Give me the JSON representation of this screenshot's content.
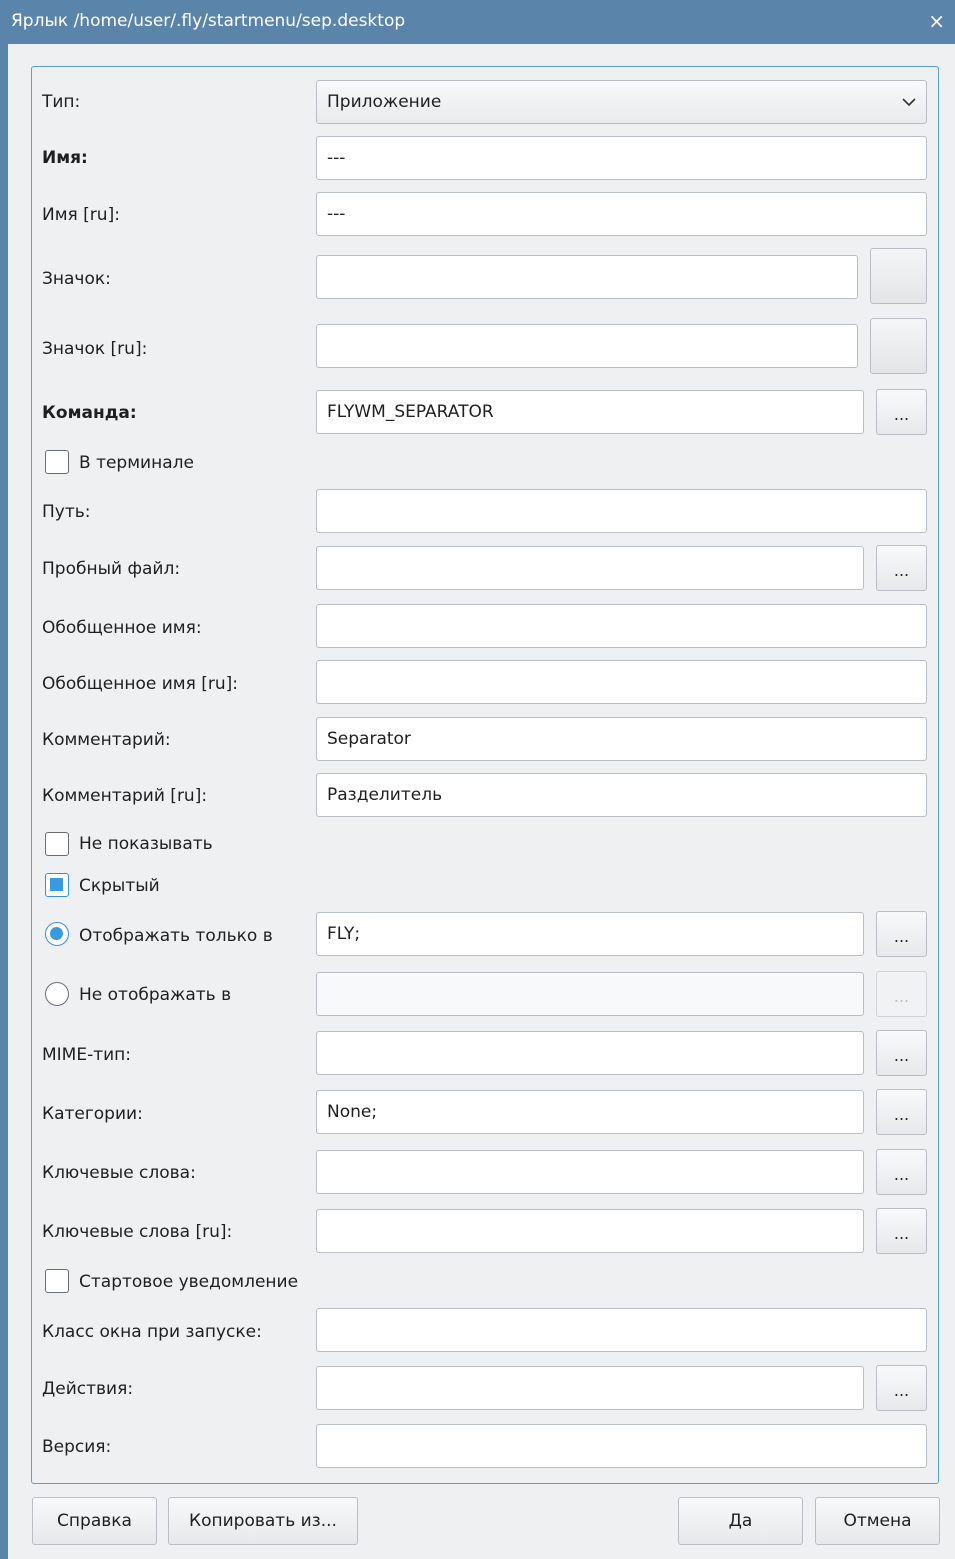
{
  "window": {
    "title": "Ярлык /home/user/.fly/startmenu/sep.desktop",
    "close_glyph": "×"
  },
  "form": {
    "type_label": "Тип:",
    "type_value": "Приложение",
    "name_label": "Имя:",
    "name_value": "---",
    "name_ru_label": "Имя [ru]:",
    "name_ru_value": "---",
    "icon_label": "Значок:",
    "icon_value": "",
    "icon_ru_label": "Значок [ru]:",
    "icon_ru_value": "",
    "command_label": "Команда:",
    "command_value": "FLYWM_SEPARATOR",
    "in_terminal_label": "В терминале",
    "path_label": "Путь:",
    "path_value": "",
    "tryexec_label": "Пробный файл:",
    "tryexec_value": "",
    "generic_name_label": "Обобщенное имя:",
    "generic_name_value": "",
    "generic_name_ru_label": "Обобщенное имя [ru]:",
    "generic_name_ru_value": "",
    "comment_label": "Комментарий:",
    "comment_value": "Separator",
    "comment_ru_label": "Комментарий [ru]:",
    "comment_ru_value": "Разделитель",
    "no_display_label": "Не показывать",
    "hidden_label": "Скрытый",
    "only_show_in_label": "Отображать только в",
    "only_show_in_value": "FLY;",
    "not_show_in_label": "Не отображать в",
    "not_show_in_value": "",
    "mime_label": "MIME-тип:",
    "mime_value": "",
    "categories_label": "Категории:",
    "categories_value": "None;",
    "keywords_label": "Ключевые слова:",
    "keywords_value": "",
    "keywords_ru_label": "Ключевые слова [ru]:",
    "keywords_ru_value": "",
    "startup_notify_label": "Стартовое уведомление",
    "wm_class_label": "Класс окна при запуске:",
    "wm_class_value": "",
    "actions_label": "Действия:",
    "actions_value": "",
    "version_label": "Версия:",
    "version_value": "",
    "browse_label": "..."
  },
  "state": {
    "in_terminal": false,
    "no_display": false,
    "hidden": true,
    "only_show_in_selected": true,
    "not_show_in_selected": false
  },
  "buttons": {
    "help": "Справка",
    "copy_from": "Копировать из...",
    "ok": "Да",
    "cancel": "Отмена"
  },
  "colors": {
    "titlebar": "#5b84aa",
    "accent": "#3a9ae0",
    "panel_border": "#5b9fd2"
  },
  "icons": {
    "close": "close-icon",
    "dropdown": "chevron-down-icon"
  }
}
